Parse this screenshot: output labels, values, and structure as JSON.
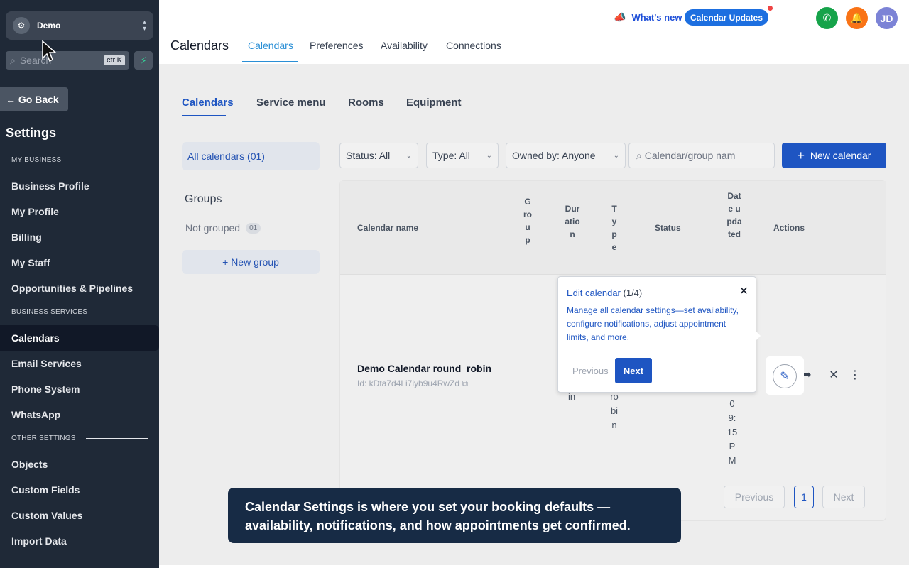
{
  "sidebar": {
    "account_name": "Demo",
    "search_placeholder": "Search",
    "search_shortcut": "ctrlK",
    "go_back": "Go Back",
    "settings_title": "Settings",
    "sections": {
      "my_business": "MY BUSINESS",
      "business_services": "BUSINESS SERVICES",
      "other_settings": "OTHER SETTINGS"
    },
    "items": [
      "Business Profile",
      "My Profile",
      "Billing",
      "My Staff",
      "Opportunities & Pipelines",
      "Calendars",
      "Email Services",
      "Phone System",
      "WhatsApp",
      "Objects",
      "Custom Fields",
      "Custom Values",
      "Import Data"
    ],
    "active_item": "Calendars"
  },
  "topbar": {
    "page_title": "Calendars",
    "tabs": [
      "Calendars",
      "Preferences",
      "Availability",
      "Connections"
    ],
    "whats_new": "What's new",
    "updates_pill": "Calendar Updates",
    "avatar_initials": "JD",
    "colors": {
      "phone": "#16a34a",
      "bell": "#f97316",
      "avatar": "#7c83d6"
    }
  },
  "subtabs": [
    "Calendars",
    "Service menu",
    "Rooms",
    "Equipment"
  ],
  "left_panel": {
    "all_calendars": "All calendars (01)",
    "groups_title": "Groups",
    "not_grouped": "Not grouped",
    "not_grouped_count": "01",
    "new_group": "New group"
  },
  "filters": {
    "status": "Status: All",
    "type": "Type: All",
    "owned_by": "Owned by: Anyone",
    "search_placeholder": "Calendar/group nam",
    "new_calendar": "New calendar"
  },
  "table": {
    "headers": {
      "name": "Calendar name",
      "group": "Group",
      "duration": "Duration",
      "type": "Type",
      "status": "Status",
      "date_updated": "Date updated",
      "actions": "Actions"
    },
    "row": {
      "name": "Demo Calendar round_robin",
      "id": "Id: kDta7d4Li7iyb9u4RwZd",
      "duration_fragment": "in",
      "type_fragment": "robin",
      "date_fragment": "09:15PM"
    },
    "pagination": {
      "previous": "Previous",
      "page": "1",
      "next": "Next"
    }
  },
  "popover": {
    "title": "Edit calendar",
    "step": "(1/4)",
    "body": "Manage all calendar settings—set availability, configure notifications, adjust appointment limits, and more.",
    "previous": "Previous",
    "next": "Next"
  },
  "caption": "Calendar Settings is where you set your booking defaults — availability, notifications, and how appointments get confirmed."
}
